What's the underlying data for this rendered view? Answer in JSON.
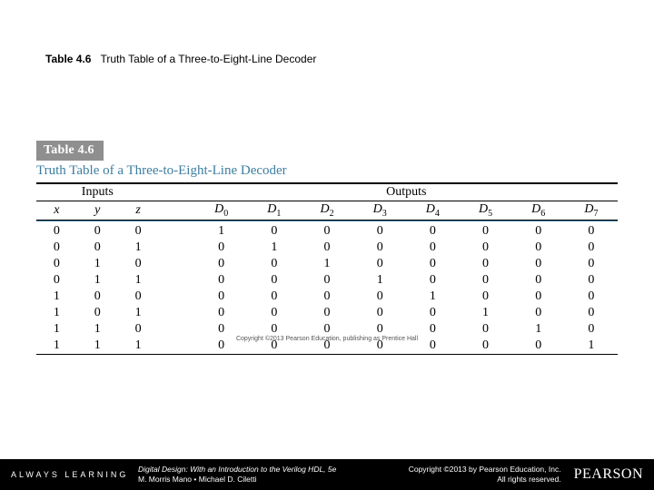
{
  "heading": {
    "num": "Table 4.6",
    "title": "Truth Table of a Three-to-Eight-Line Decoder"
  },
  "table": {
    "label": "Table 4.6",
    "caption": "Truth Table of a Three-to-Eight-Line Decoder",
    "group_inputs": "Inputs",
    "group_outputs": "Outputs",
    "in_headers": [
      "x",
      "y",
      "z"
    ],
    "out_headers": [
      "D",
      "D",
      "D",
      "D",
      "D",
      "D",
      "D",
      "D"
    ],
    "out_subs": [
      "0",
      "1",
      "2",
      "3",
      "4",
      "5",
      "6",
      "7"
    ],
    "image_credit": "Copyright ©2013 Pearson Education, publishing as Prentice Hall"
  },
  "chart_data": {
    "type": "table",
    "columns": [
      "x",
      "y",
      "z",
      "D0",
      "D1",
      "D2",
      "D3",
      "D4",
      "D5",
      "D6",
      "D7"
    ],
    "rows": [
      [
        0,
        0,
        0,
        1,
        0,
        0,
        0,
        0,
        0,
        0,
        0
      ],
      [
        0,
        0,
        1,
        0,
        1,
        0,
        0,
        0,
        0,
        0,
        0
      ],
      [
        0,
        1,
        0,
        0,
        0,
        1,
        0,
        0,
        0,
        0,
        0
      ],
      [
        0,
        1,
        1,
        0,
        0,
        0,
        1,
        0,
        0,
        0,
        0
      ],
      [
        1,
        0,
        0,
        0,
        0,
        0,
        0,
        1,
        0,
        0,
        0
      ],
      [
        1,
        0,
        1,
        0,
        0,
        0,
        0,
        0,
        1,
        0,
        0
      ],
      [
        1,
        1,
        0,
        0,
        0,
        0,
        0,
        0,
        0,
        1,
        0
      ],
      [
        1,
        1,
        1,
        0,
        0,
        0,
        0,
        0,
        0,
        0,
        1
      ]
    ]
  },
  "footer": {
    "always": "ALWAYS LEARNING",
    "book_title": "Digital Design: With an Introduction to the Verilog HDL, 5e",
    "authors": "M. Morris Mano • Michael D. Ciletti",
    "copyright_line1": "Copyright ©2013 by Pearson Education, Inc.",
    "copyright_line2": "All rights reserved.",
    "brand": "PEARSON"
  }
}
